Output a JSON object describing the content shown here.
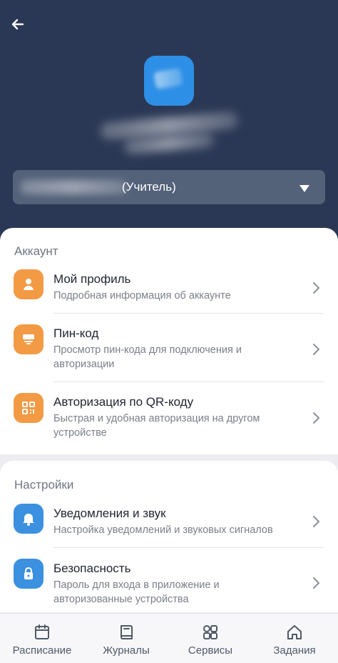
{
  "header": {
    "back_icon": "arrow-left-icon",
    "role": "(Учитель)"
  },
  "sections": {
    "account": {
      "title": "Аккаунт",
      "items": [
        {
          "title": "Мой профиль",
          "subtitle": "Подробная информация об аккаунте",
          "icon": "person-icon"
        },
        {
          "title": "Пин-код",
          "subtitle": "Просмотр пин-кода для подключения и авторизации",
          "icon": "pin-device-icon"
        },
        {
          "title": "Авторизация по QR-коду",
          "subtitle": "Быстрая и удобная авторизация на другом устройстве",
          "icon": "qr-code-icon"
        }
      ]
    },
    "settings": {
      "title": "Настройки",
      "items": [
        {
          "title": "Уведомления и звук",
          "subtitle": "Настройка уведомлений и звуковых сигналов",
          "icon": "bell-icon"
        },
        {
          "title": "Безопасность",
          "subtitle": "Пароль для входа в приложение и авторизованные устройства",
          "icon": "lock-icon"
        }
      ]
    }
  },
  "bottom_nav": [
    {
      "label": "Расписание",
      "icon": "calendar-icon"
    },
    {
      "label": "Журналы",
      "icon": "book-icon"
    },
    {
      "label": "Сервисы",
      "icon": "grid-icon"
    },
    {
      "label": "Задания",
      "icon": "home-icon"
    }
  ],
  "colors": {
    "header_background": "#2b3855",
    "role_select_background": "#536179",
    "account_icon_background": "#f39a45",
    "settings_icon_background": "#3b90df",
    "screen_background": "#ececf1"
  }
}
